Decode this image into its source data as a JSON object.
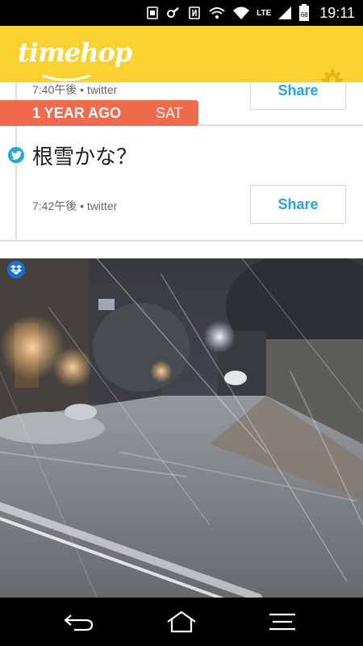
{
  "status_bar": {
    "time": "19:11",
    "network": "LTE",
    "battery": "68",
    "icons": [
      "sim-icon",
      "vpn-key-icon",
      "nfc-icon",
      "vibrate-icon",
      "wifi-call-icon",
      "wifi-icon",
      "signal-icon",
      "battery-icon"
    ]
  },
  "app_bar": {
    "logo": "timehop",
    "settings_icon": "gear-icon",
    "color": "#f9d231"
  },
  "feed": {
    "previous_post": {
      "meta": "7:40午後 • twitter",
      "share_label": "Share"
    },
    "ribbon": {
      "label": "1 YEAR AGO",
      "day": "SAT",
      "color": "#f06a4e"
    },
    "post": {
      "source_icon": "twitter-icon",
      "text": "根雪かな？",
      "meta": "7:42午後 • twitter",
      "share_label": "Share"
    },
    "photo": {
      "source_icon": "dropbox-icon"
    }
  },
  "nav_bar": {
    "buttons": [
      "back-icon",
      "home-icon",
      "menu-icon"
    ]
  },
  "colors": {
    "accent_blue": "#29a3e0"
  }
}
